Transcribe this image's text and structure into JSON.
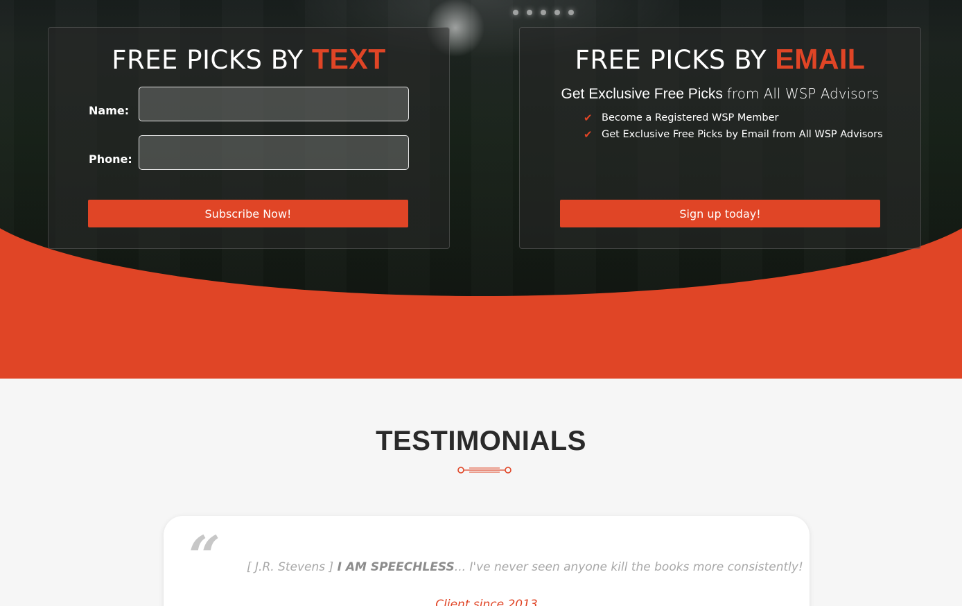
{
  "text_panel": {
    "title_prefix": "FREE PICKS BY",
    "title_highlight": "TEXT",
    "name_label": "Name:",
    "name_value": "",
    "phone_label": "Phone:",
    "phone_value": "",
    "button_label": "Subscribe Now!"
  },
  "email_panel": {
    "title_prefix": "FREE PICKS BY",
    "title_highlight": "EMAIL",
    "subtitle_strong": "Get Exclusive Free Picks",
    "subtitle_rest": "from All WSP Advisors",
    "benefits": [
      "Become a Registered WSP Member",
      "Get Exclusive Free Picks by Email from All WSP Advisors"
    ],
    "button_label": "Sign up today!"
  },
  "testimonials": {
    "title": "TESTIMONIALS",
    "quote_mark": "“",
    "author": "[ J.R. Stevens ]",
    "headline": "I AM SPEECHLESS",
    "body": "... I've never seen anyone kill the books more consistently!",
    "client_since": "Client since 2013"
  },
  "colors": {
    "accent": "#e04526",
    "dark_bg": "#141718",
    "light_bg": "#f6f6f6"
  }
}
